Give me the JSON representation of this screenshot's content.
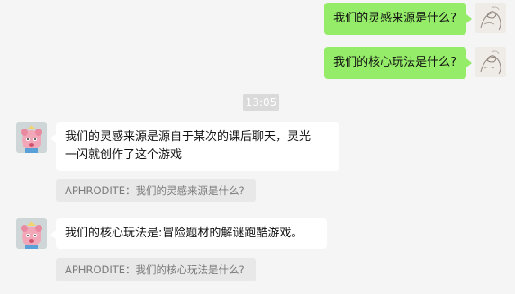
{
  "messages_out": [
    {
      "text": "我们的灵感来源是什么?"
    },
    {
      "text": "我们的核心玩法是什么?"
    }
  ],
  "time_divider": "13:05",
  "messages_in": [
    {
      "line1": "我们的灵感来源是源自于某次的课后聊天，灵光",
      "line2": "一闪就创作了这个游戏",
      "quote": "APHRODITE：我们的灵感来源是什么?"
    },
    {
      "line1": "我们的核心玩法是:冒险题材的解谜跑酷游戏。",
      "quote": "APHRODITE：我们的核心玩法是什么?"
    }
  ],
  "colors": {
    "background": "#f5f5f5",
    "outgoing_bubble": "#95ec69",
    "incoming_bubble": "#ffffff",
    "quote_bg": "#e8e8e8",
    "time_pill": "#dadada"
  },
  "icons": {
    "user_avatar": "sketch-figure-avatar",
    "bot_avatar": "pink-character-avatar"
  }
}
